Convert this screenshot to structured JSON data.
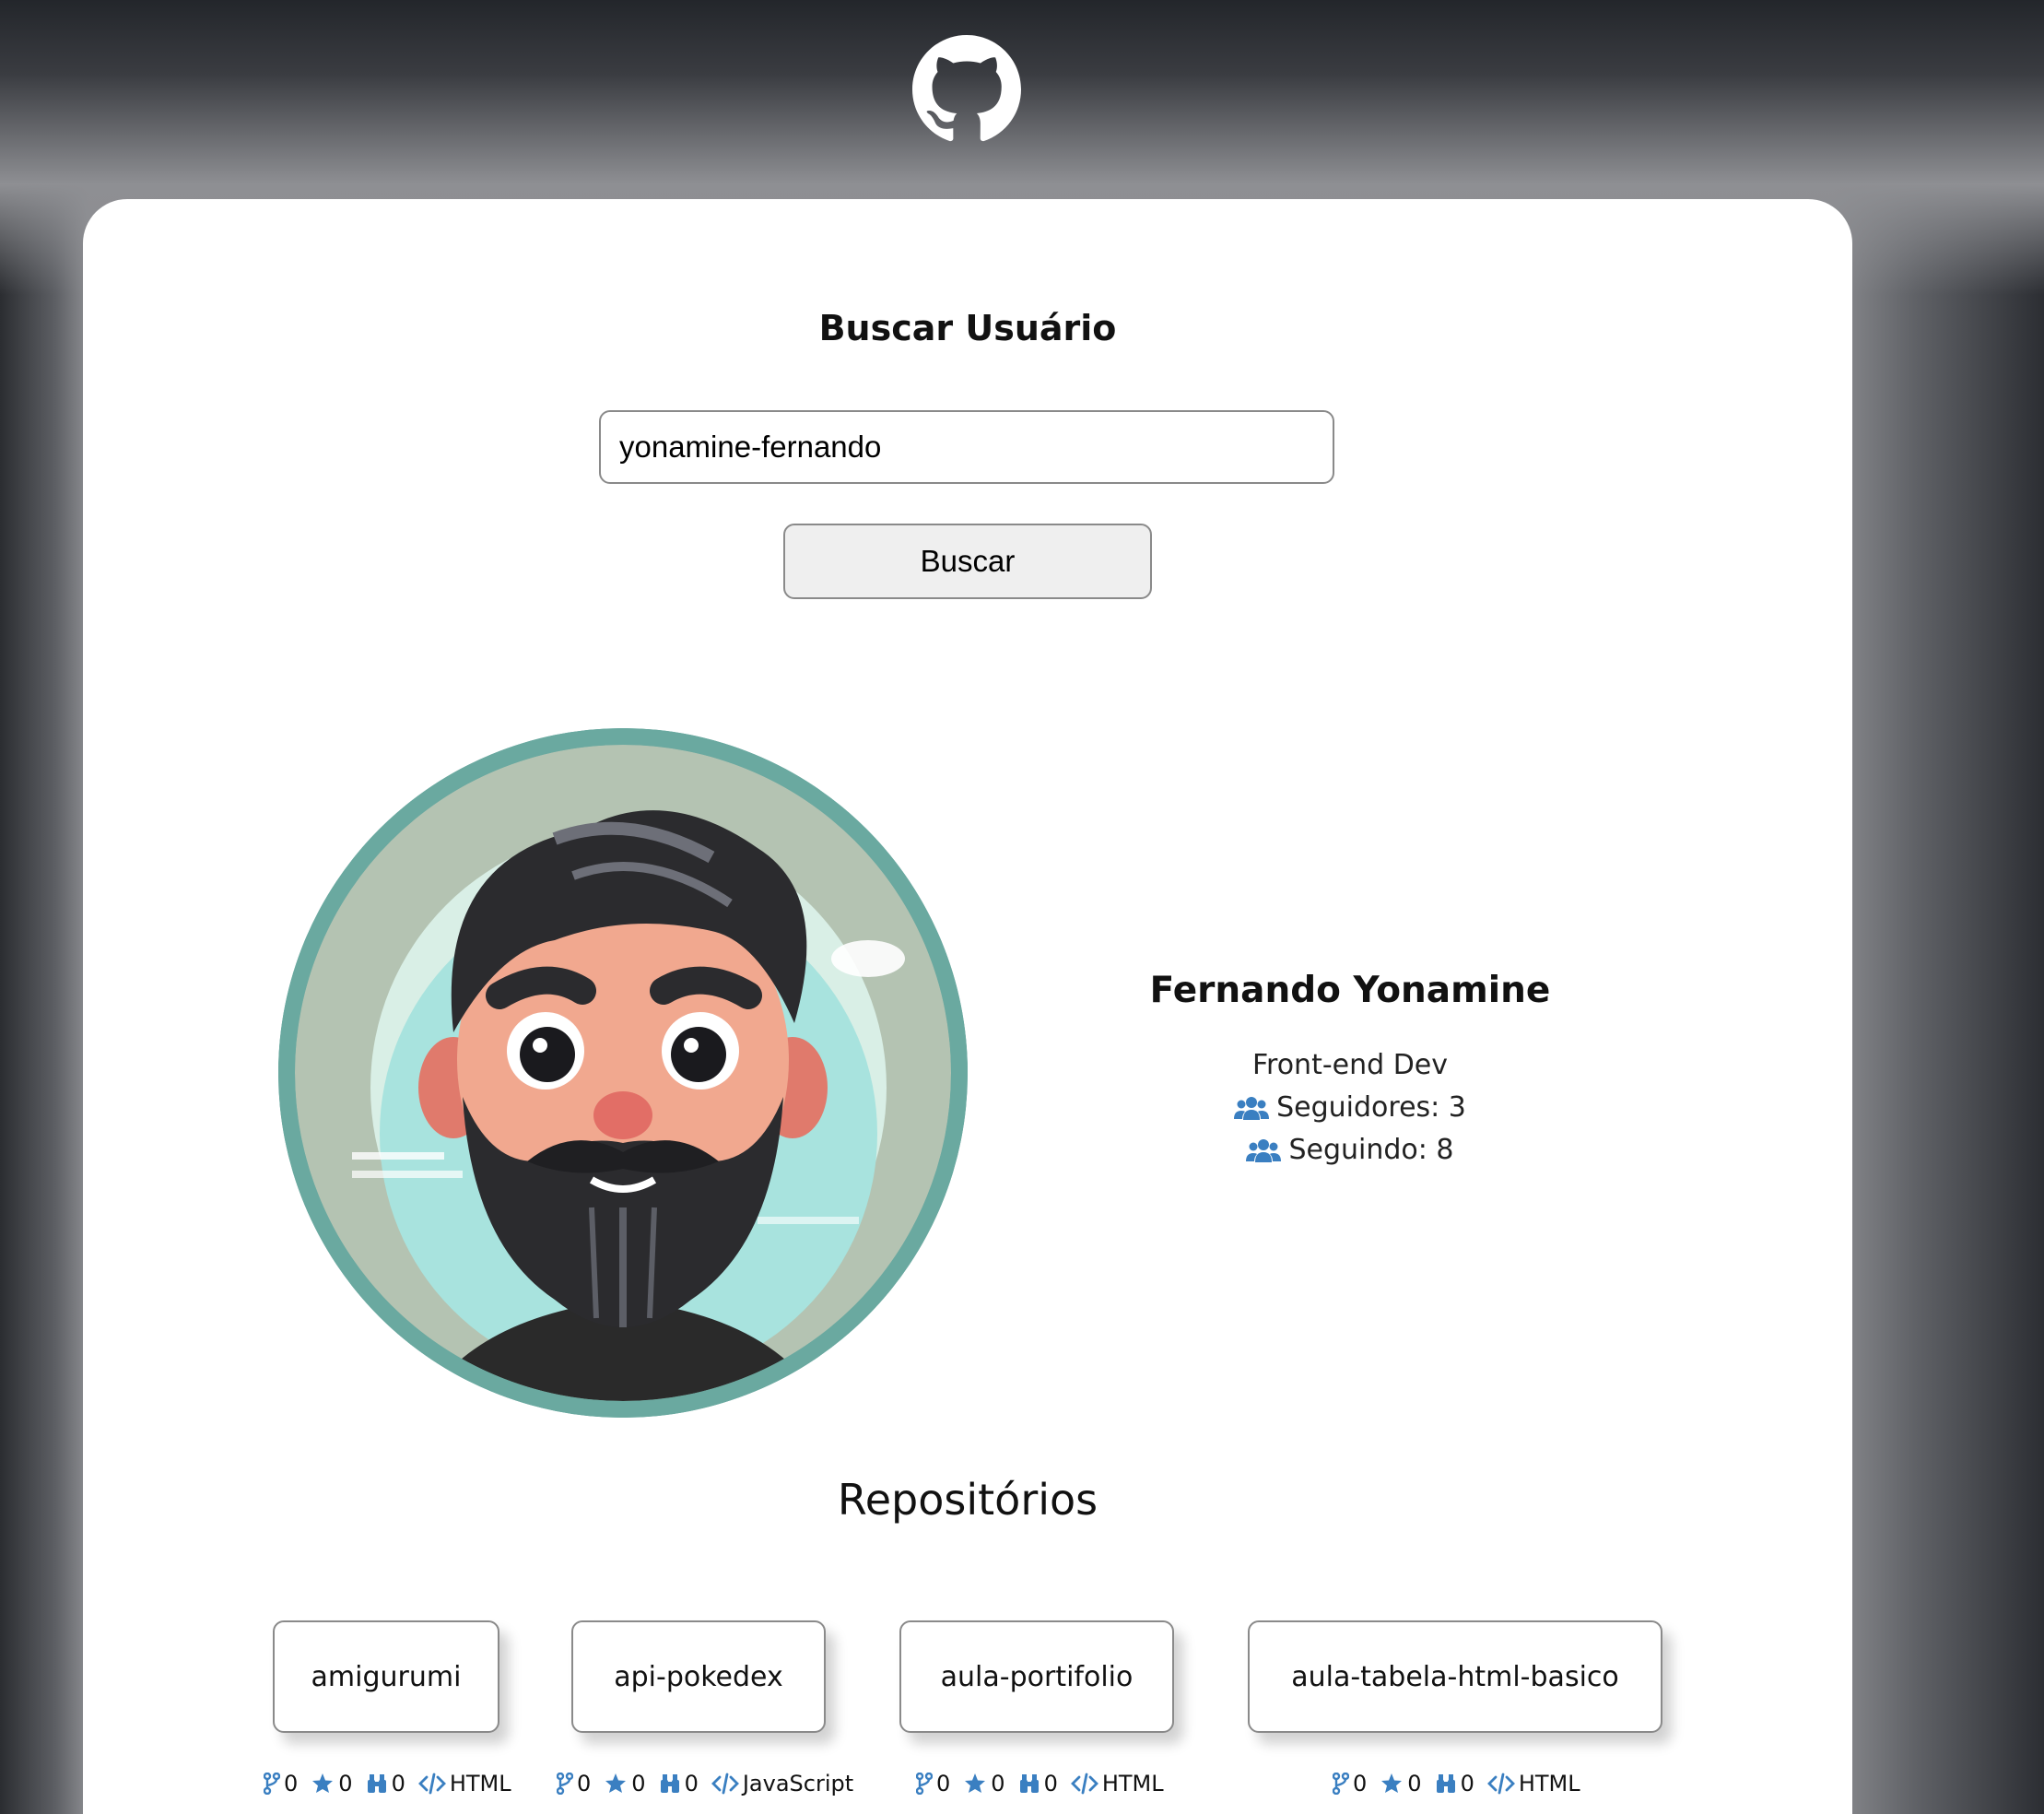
{
  "header": {
    "logo_icon": "github-icon"
  },
  "search": {
    "title": "Buscar Usuário",
    "input_value": "yonamine-fernando",
    "button_label": "Buscar"
  },
  "profile": {
    "name": "Fernando Yonamine",
    "bio": "Front-end Dev",
    "followers_label": "Seguidores: 3",
    "following_label": "Seguindo: 8",
    "avatar_icon": "cartoon-avatar"
  },
  "repos": {
    "title": "Repositórios",
    "items": [
      {
        "name": "amigurumi",
        "forks": "0",
        "stars": "0",
        "watchers": "0",
        "language": "HTML"
      },
      {
        "name": "api-pokedex",
        "forks": "0",
        "stars": "0",
        "watchers": "0",
        "language": "JavaScript"
      },
      {
        "name": "aula-portifolio",
        "forks": "0",
        "stars": "0",
        "watchers": "0",
        "language": "HTML"
      },
      {
        "name": "aula-tabela-html-basico",
        "forks": "0",
        "stars": "0",
        "watchers": "0",
        "language": "HTML"
      }
    ]
  },
  "colors": {
    "icon_blue": "#3a7fc1",
    "avatar_ring": "#6aa9a0"
  }
}
